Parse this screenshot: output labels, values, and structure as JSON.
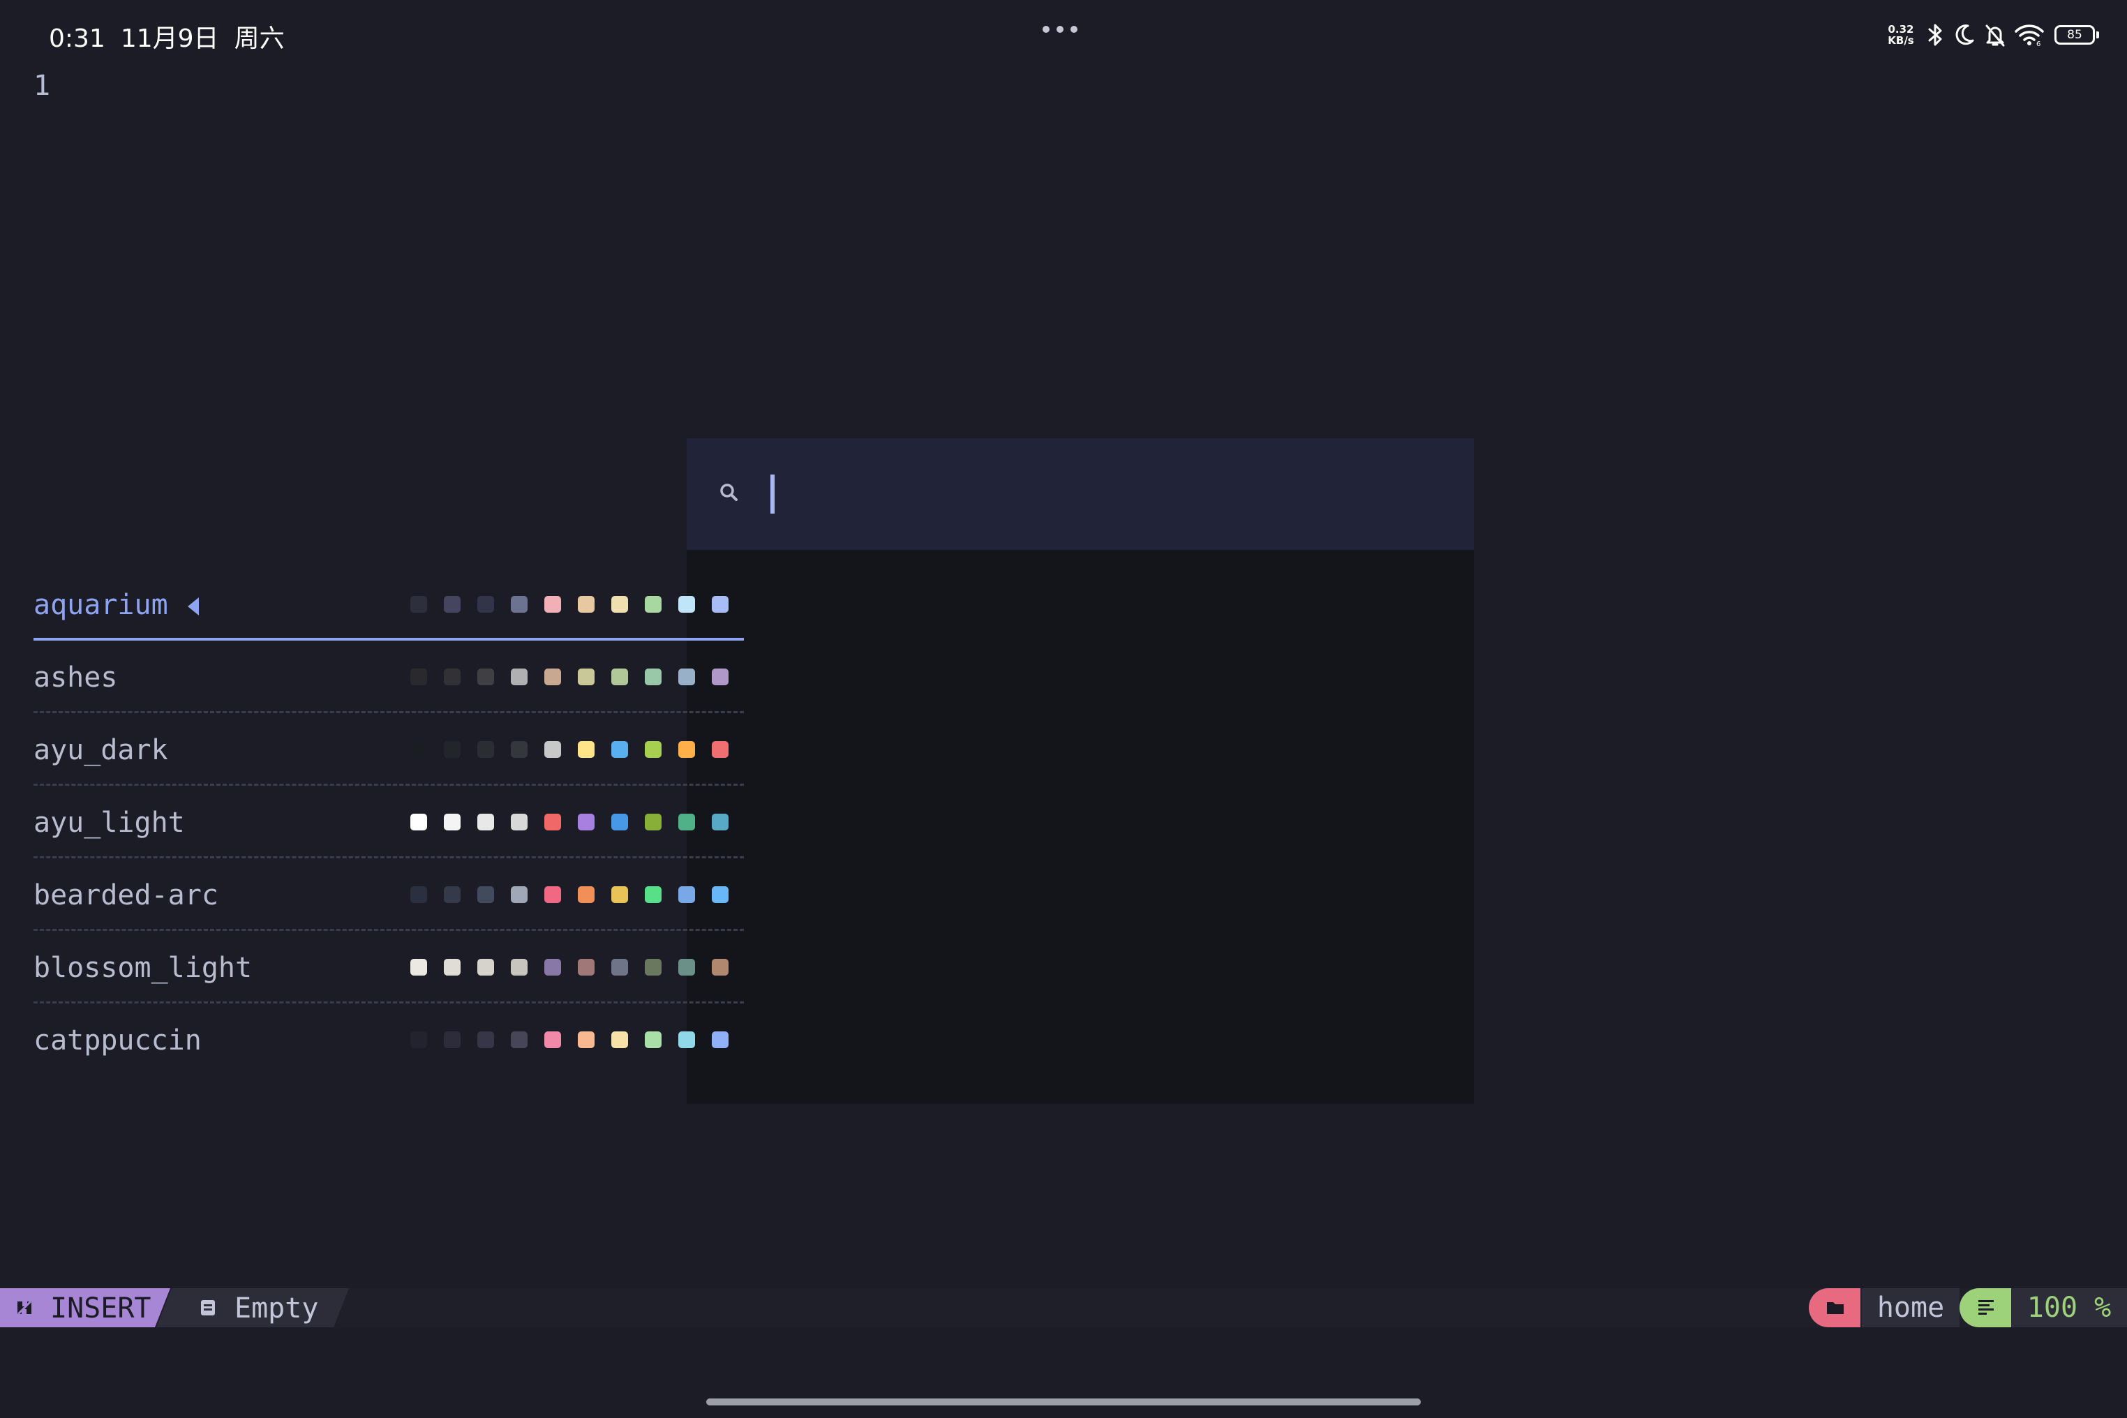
{
  "status_bar": {
    "time": "0:31",
    "date": "11月9日",
    "weekday": "周六",
    "net_speed_value": "0.32",
    "net_speed_unit": "KB/s",
    "battery": "85",
    "icons": [
      "bluetooth-icon",
      "moon-icon",
      "bell-muted-icon",
      "wifi-icon",
      "battery-icon"
    ]
  },
  "editor": {
    "line_number": "1"
  },
  "picker": {
    "search_value": "",
    "themes": [
      {
        "name": "aquarium",
        "active": true,
        "swatches": [
          "#2e2f3d",
          "#454560",
          "#32344a",
          "#6b7391",
          "#f0b0b5",
          "#e8c8a0",
          "#f0e0b0",
          "#a8d8a0",
          "#c0e4f8",
          "#a8bcf5"
        ]
      },
      {
        "name": "ashes",
        "active": false,
        "swatches": [
          "#2a2a2e",
          "#323236",
          "#404044",
          "#b0b0b2",
          "#c8a890",
          "#c8c898",
          "#b0c898",
          "#98c8a8",
          "#98b0c8",
          "#b098c8"
        ]
      },
      {
        "name": "ayu_dark",
        "active": false,
        "swatches": [
          "#1a1d22",
          "#22252a",
          "#2a2d32",
          "#34373c",
          "#c8c8c8",
          "#ffe48a",
          "#58b0f0",
          "#a8d050",
          "#ffb048",
          "#f07070"
        ]
      },
      {
        "name": "ayu_light",
        "active": false,
        "swatches": [
          "#ffffff",
          "#f4f4f4",
          "#e8e8e8",
          "#d8d8d8",
          "#f06868",
          "#a880e0",
          "#4898e8",
          "#88b038",
          "#50b088",
          "#58a8c8"
        ]
      },
      {
        "name": "bearded-arc",
        "active": false,
        "swatches": [
          "#2a3040",
          "#343a4a",
          "#424a5e",
          "#a0a8b8",
          "#f06882",
          "#f09058",
          "#e8c458",
          "#58e088",
          "#78a8e8",
          "#68b8f8"
        ]
      },
      {
        "name": "blossom_light",
        "active": false,
        "swatches": [
          "#ece8e2",
          "#e0dcd6",
          "#d6d2cc",
          "#c8c4be",
          "#8878a8",
          "#a07878",
          "#6f7488",
          "#6a7860",
          "#6a9088",
          "#b08870"
        ]
      },
      {
        "name": "catppuccin",
        "active": false,
        "swatches": [
          "#232330",
          "#2c2c3a",
          "#363648",
          "#464658",
          "#f08aa8",
          "#f8b890",
          "#f8e2a8",
          "#a8e0a8",
          "#90d8e8",
          "#90b0f8"
        ]
      }
    ]
  },
  "statusline": {
    "mode": "INSERT",
    "file": "Empty",
    "directory": "home",
    "progress": "100 %",
    "colors": {
      "mode_bg": "#a886d6",
      "dir_bg": "#e86a80",
      "pct_bg": "#9dd17a"
    }
  }
}
